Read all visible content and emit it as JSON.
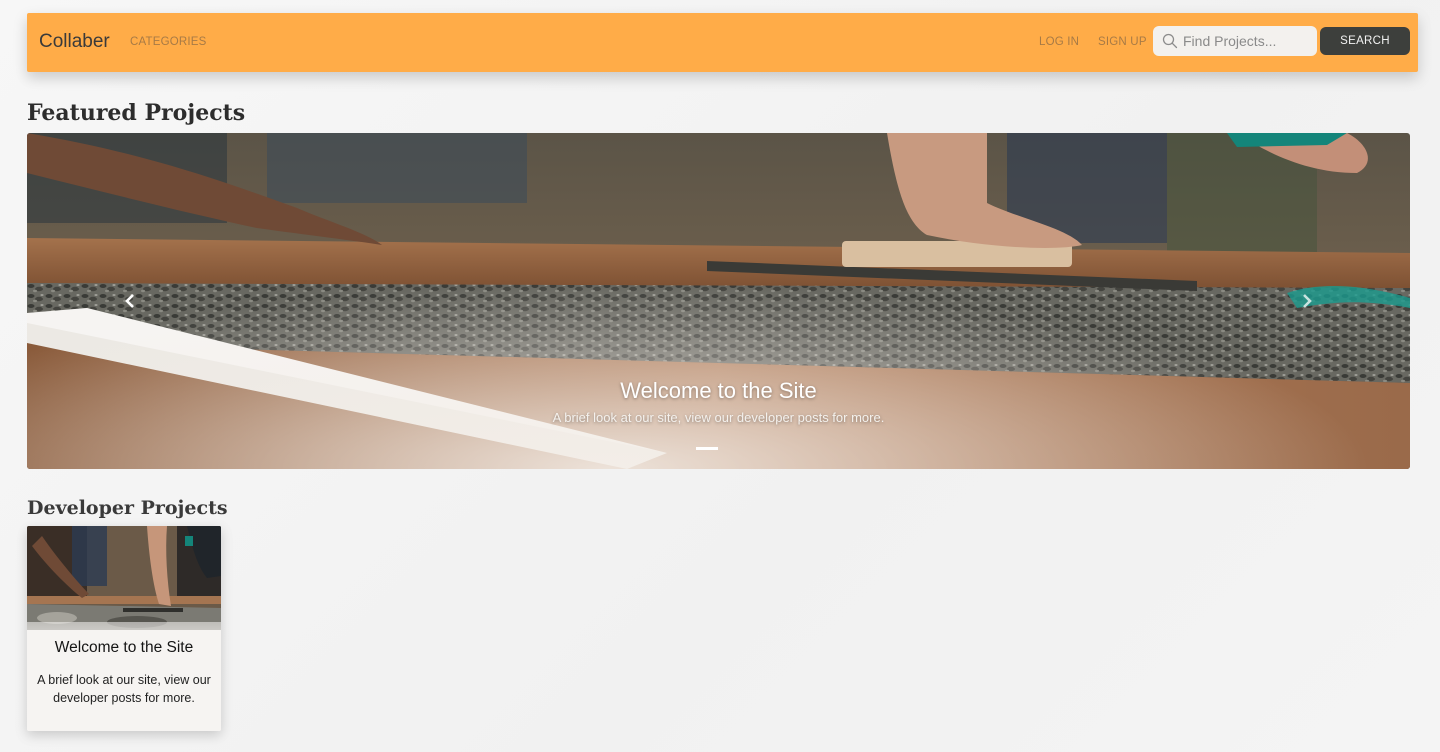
{
  "navbar": {
    "brand": "Collaber",
    "categories": "CATEGORIES",
    "login": "LOG IN",
    "signup": "SIGN UP",
    "search_placeholder": "Find Projects...",
    "search_button": "SEARCH",
    "bg_color": "#ffac48"
  },
  "featured": {
    "title": "Featured Projects",
    "slide": {
      "title": "Welcome to the Site",
      "text": "A brief look at our site, view our developer posts for more.",
      "image": "concrete-smoothing-photo"
    }
  },
  "developer_projects": {
    "title": "Developer Projects",
    "cards": [
      {
        "title": "Welcome to the Site",
        "text": "A brief look at our site, view our developer posts for more.",
        "image": "concrete-smoothing-photo"
      }
    ]
  },
  "colors": {
    "accent": "#ffac48",
    "button_dark": "#3d3f3c",
    "page_bg": "#f4f4f4"
  }
}
